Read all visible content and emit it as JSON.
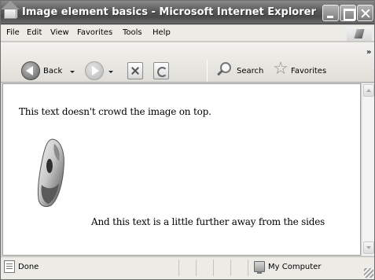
{
  "window": {
    "title": "Image element basics - Microsoft Internet Explorer"
  },
  "menu": {
    "items": [
      "File",
      "Edit",
      "View",
      "Favorites",
      "Tools",
      "Help"
    ]
  },
  "toolbar": {
    "back_label": "Back",
    "search_label": "Search",
    "favorites_label": "Favorites",
    "overflow": "»"
  },
  "page": {
    "text_top": "This text doesn't crowd the image on top.",
    "text_bottom": "And this text is a little further away from the sides"
  },
  "status": {
    "left_text": "Done",
    "zone_text": "My Computer"
  },
  "icons": {
    "app": "ie-app-icon",
    "back": "back-arrow-icon",
    "forward": "forward-arrow-icon",
    "stop": "stop-icon",
    "refresh": "refresh-icon",
    "home": "home-icon",
    "search": "search-icon",
    "favorites": "favorites-star-icon",
    "zone": "computer-icon"
  }
}
